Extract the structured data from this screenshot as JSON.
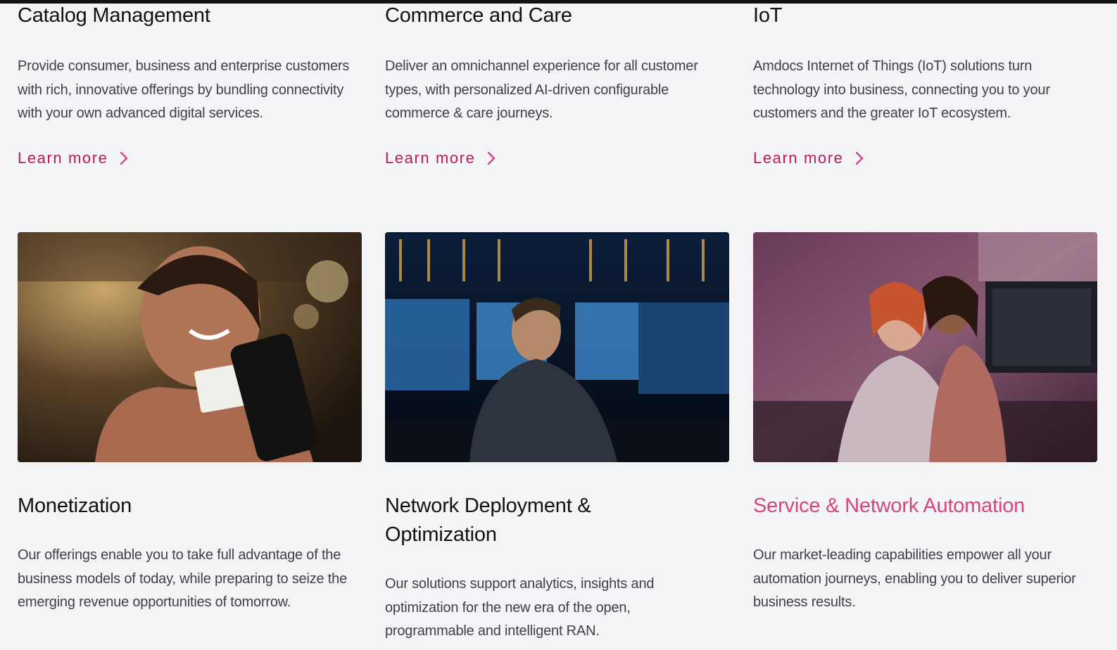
{
  "top_row": [
    {
      "title": "Catalog Management",
      "description": "Provide consumer, business and enterprise customers with rich, innovative offerings by bundling connectivity with your own advanced digital services.",
      "link": "Learn more"
    },
    {
      "title": "Commerce and Care",
      "description": "Deliver an omnichannel experience for all customer types, with personalized AI-driven configurable commerce & care journeys.",
      "link": "Learn more"
    },
    {
      "title": "IoT",
      "description": "Amdocs Internet of Things (IoT) solutions turn technology into business, connecting you to your customers and the greater IoT ecosystem.",
      "link": "Learn more"
    }
  ],
  "bottom_row": [
    {
      "title": "Monetization",
      "description": "Our offerings enable you to take full advantage of the business models of today, while preparing to seize the emerging revenue opportunities of tomorrow.",
      "image": "woman-paying-with-phone-and-card"
    },
    {
      "title": "Network Deployment & Optimization",
      "description": "Our solutions support analytics, insights and optimization for the new era of the open, programmable and intelligent RAN.",
      "image": "engineer-at-monitors-in-data-center"
    },
    {
      "title": "Service & Network Automation",
      "description": "Our market-leading capabilities empower all your automation journeys, enabling you to deliver superior business results.",
      "image": "two-women-working-at-computers"
    }
  ],
  "colors": {
    "background": "#f3f4f6",
    "heading": "#111111",
    "body_text": "#3f3f46",
    "accent": "#d6457e",
    "link": "#c2185b"
  }
}
